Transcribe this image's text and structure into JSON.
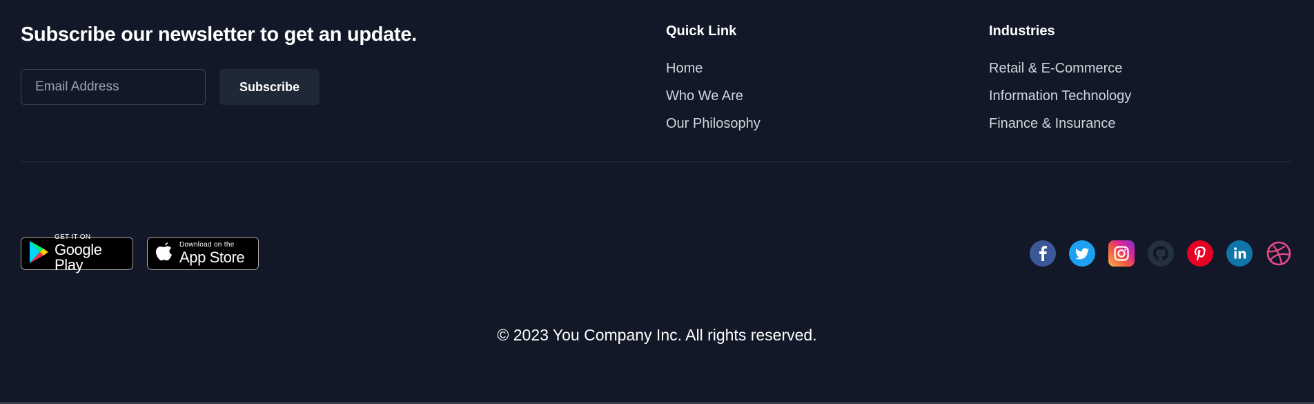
{
  "newsletter": {
    "title": "Subscribe our newsletter to get an update.",
    "email_placeholder": "Email Address",
    "email_value": "",
    "subscribe_label": "Subscribe"
  },
  "quick_links": {
    "heading": "Quick Link",
    "items": [
      "Home",
      "Who We Are",
      "Our Philosophy"
    ]
  },
  "industries": {
    "heading": "Industries",
    "items": [
      "Retail & E-Commerce",
      "Information Technology",
      "Finance & Insurance"
    ]
  },
  "app_badges": {
    "google_small": "GET IT ON",
    "google_big": "Google Play",
    "apple_small": "Download on the",
    "apple_big": "App Store"
  },
  "social": {
    "icons": [
      "facebook-icon",
      "twitter-icon",
      "instagram-icon",
      "github-icon",
      "pinterest-icon",
      "linkedin-icon",
      "dribbble-icon"
    ],
    "colors": {
      "facebook": "#3b5998",
      "twitter": "#1da1f2",
      "instagram": "#d6249f",
      "github": "#24313f",
      "pinterest": "#e60023",
      "linkedin": "#0e76a8",
      "dribbble": "#ea4c89"
    }
  },
  "copyright": "© 2023 You Company Inc. All rights reserved."
}
